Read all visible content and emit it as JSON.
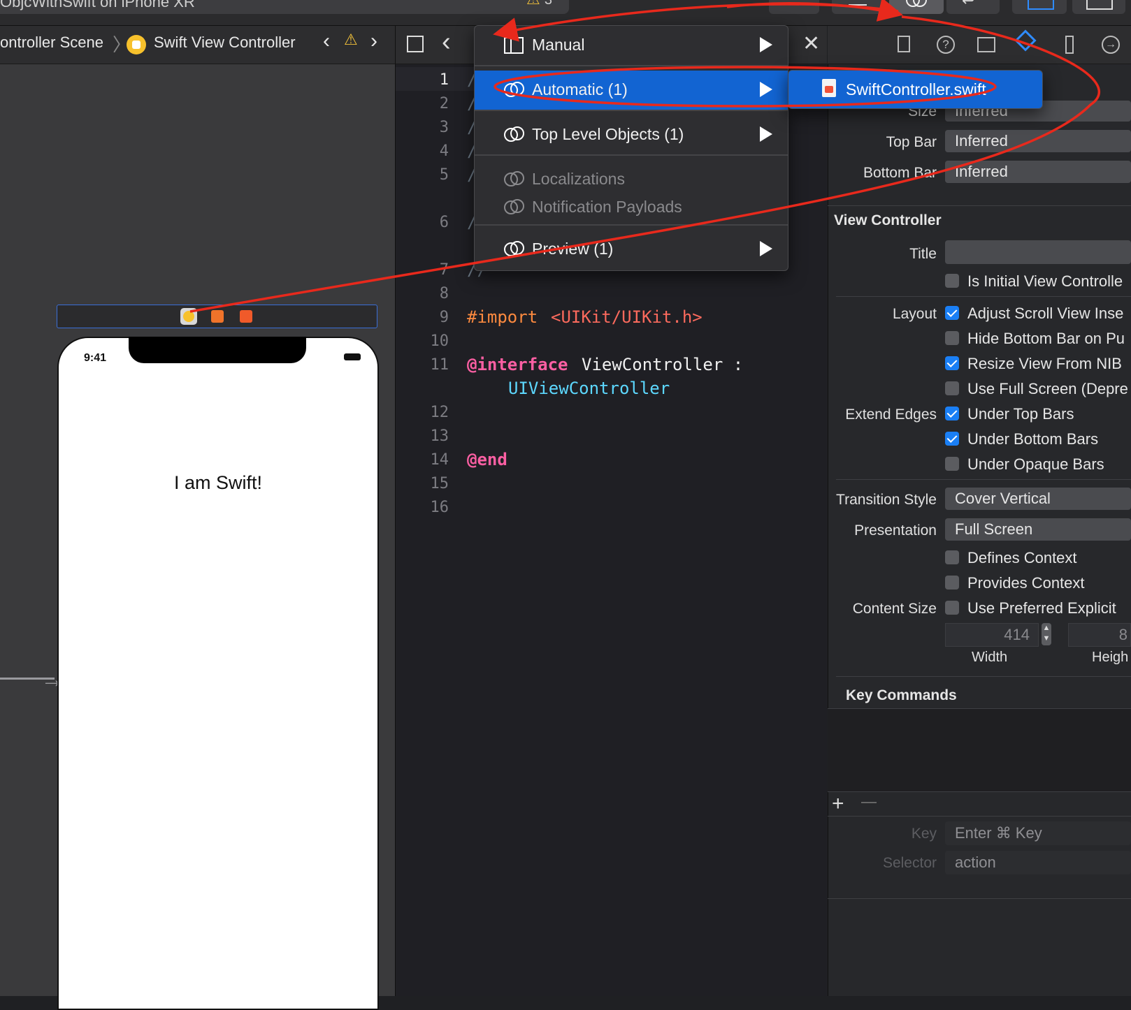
{
  "toolbar": {
    "scheme": "ObjcWithSwift on iPhone XR",
    "warning_count": "3"
  },
  "canvas": {
    "breadcrumb": {
      "scene": "ontroller Scene",
      "controller": "Swift View Controller"
    },
    "phone": {
      "time": "9:41",
      "label": "I am Swift!"
    }
  },
  "editor": {
    "lines": [
      "1",
      "2",
      "3",
      "4",
      "5",
      "6",
      "7",
      "8",
      "9",
      "10",
      "11",
      "12",
      "13",
      "14",
      "15",
      "16"
    ],
    "code": {
      "import_kw": "#import",
      "import_path": "<UIKit/UIKit.h>",
      "interface_kw": "@interface",
      "interface_name": "ViewController :",
      "super_class": "UIViewController",
      "end_kw": "@end",
      "comment_prefix": "/",
      "comment_close": "//"
    }
  },
  "related_menu": {
    "items": [
      {
        "label": "Manual"
      },
      {
        "label": "Automatic (1)"
      },
      {
        "label": "Top Level Objects (1)"
      },
      {
        "label": "Localizations"
      },
      {
        "label": "Notification Payloads"
      },
      {
        "label": "Preview (1)"
      }
    ],
    "submenu_file": "SwiftController.swift"
  },
  "inspector": {
    "size": {
      "label": "Size",
      "value": "Inferred"
    },
    "top_bar": {
      "label": "Top Bar",
      "value": "Inferred"
    },
    "bottom_bar": {
      "label": "Bottom Bar",
      "value": "Inferred"
    },
    "section_vc": "View Controller",
    "title_label": "Title",
    "title_value": "",
    "is_initial": "Is Initial View Controlle",
    "layout_label": "Layout",
    "layout_opts": [
      {
        "label": "Adjust Scroll View Inse",
        "checked": true
      },
      {
        "label": "Hide Bottom Bar on Pu",
        "checked": false
      },
      {
        "label": "Resize View From NIB",
        "checked": true
      },
      {
        "label": "Use Full Screen (Depre",
        "checked": false
      }
    ],
    "extend_label": "Extend Edges",
    "extend_opts": [
      {
        "label": "Under Top Bars",
        "checked": true
      },
      {
        "label": "Under Bottom Bars",
        "checked": true
      },
      {
        "label": "Under Opaque Bars",
        "checked": false
      }
    ],
    "transition": {
      "label": "Transition Style",
      "value": "Cover Vertical"
    },
    "presentation": {
      "label": "Presentation",
      "value": "Full Screen"
    },
    "defines_context": "Defines Context",
    "provides_context": "Provides Context",
    "content_size_label": "Content Size",
    "use_preferred": "Use Preferred Explicit",
    "width_value": "414",
    "width_label": "Width",
    "height_label": "Heigh",
    "height_value": "8",
    "key_commands": "Key Commands",
    "key_label": "Key",
    "key_placeholder": "Enter ⌘ Key",
    "selector_label": "Selector",
    "selector_placeholder": "action"
  },
  "colors": {
    "accent_blue": "#1264d2",
    "annotation_red": "#e8291c",
    "code_orange": "#fc8a3f",
    "code_pink": "#fc5fa3",
    "code_teal": "#5dd8ff",
    "warning_yellow": "#f3c23a"
  }
}
